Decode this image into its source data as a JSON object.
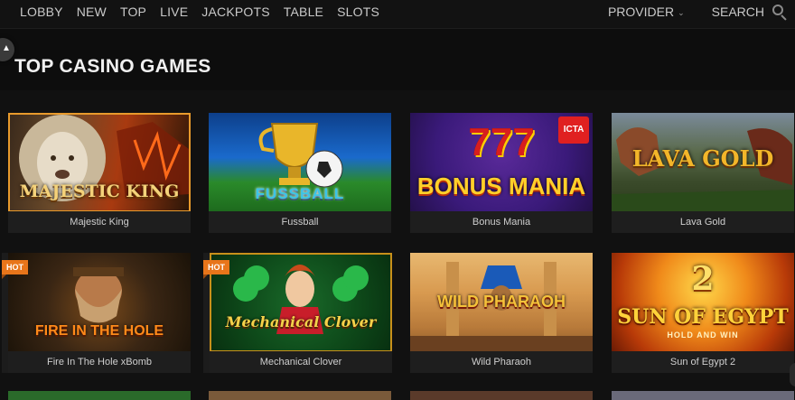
{
  "nav": {
    "items": [
      "LOBBY",
      "NEW",
      "TOP",
      "LIVE",
      "JACKPOTS",
      "TABLE",
      "SLOTS"
    ],
    "provider_label": "PROVIDER",
    "search_label": "SEARCH"
  },
  "section": {
    "title": "TOP CASINO GAMES"
  },
  "games": [
    {
      "name": "Majestic King",
      "logo": "MAJESTIC KING",
      "hot": ""
    },
    {
      "name": "Fussball",
      "logo": "FUSSBALL",
      "hot": ""
    },
    {
      "name": "Bonus Mania",
      "logo": "BONUS MANIA",
      "hot": ""
    },
    {
      "name": "Lava Gold",
      "logo": "LAVA GOLD",
      "hot": ""
    },
    {
      "name": "Fire In The Hole xBomb",
      "logo": "FIRE IN THE HOLE",
      "hot": "HOT"
    },
    {
      "name": "Mechanical Clover",
      "logo": "Mechanical Clover",
      "hot": "HOT"
    },
    {
      "name": "Wild Pharaoh",
      "logo": "WILD PHARAOH",
      "hot": ""
    },
    {
      "name": "Sun of Egypt 2",
      "logo": "SUN OF EGYPT",
      "hot": ""
    }
  ],
  "extras": {
    "bonus_mania_number": "777",
    "bonus_mania_badge": "ICTA",
    "sun_of_egypt_number": "2",
    "sun_of_egypt_tagline": "HOLD AND WIN"
  },
  "colors": {
    "background": "#0d0d0d",
    "card_label_bg": "#1e1e1e",
    "hot_badge": "#e8751a",
    "selected_border": "#e89a2c"
  }
}
